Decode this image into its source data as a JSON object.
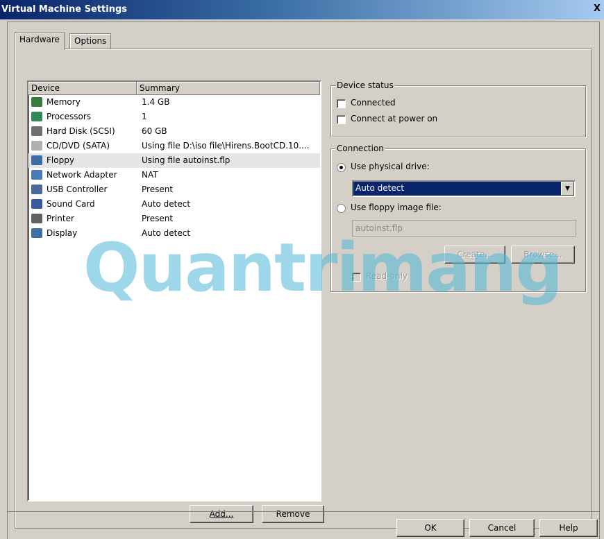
{
  "window": {
    "title": "Virtual Machine Settings",
    "close_glyph": "X"
  },
  "tabs": [
    {
      "label": "Hardware",
      "active": true
    },
    {
      "label": "Options",
      "active": false
    }
  ],
  "device_list": {
    "headers": {
      "device": "Device",
      "summary": "Summary"
    },
    "rows": [
      {
        "name": "Memory",
        "summary": "1.4 GB",
        "icon": "memory-icon",
        "color": "#3a7a3a",
        "selected": false
      },
      {
        "name": "Processors",
        "summary": "1",
        "icon": "processor-icon",
        "color": "#2e8b57",
        "selected": false
      },
      {
        "name": "Hard Disk (SCSI)",
        "summary": "60 GB",
        "icon": "hard-disk-icon",
        "color": "#707070",
        "selected": false
      },
      {
        "name": "CD/DVD (SATA)",
        "summary": "Using file D:\\iso file\\Hirens.BootCD.10....",
        "icon": "cd-dvd-icon",
        "color": "#b0b0b0",
        "selected": false
      },
      {
        "name": "Floppy",
        "summary": "Using file autoinst.flp",
        "icon": "floppy-icon",
        "color": "#3a6ea5",
        "selected": true
      },
      {
        "name": "Network Adapter",
        "summary": "NAT",
        "icon": "network-adapter-icon",
        "color": "#4a7ab8",
        "selected": false
      },
      {
        "name": "USB Controller",
        "summary": "Present",
        "icon": "usb-icon",
        "color": "#4a6a9a",
        "selected": false
      },
      {
        "name": "Sound Card",
        "summary": "Auto detect",
        "icon": "sound-card-icon",
        "color": "#3a5aa0",
        "selected": false
      },
      {
        "name": "Printer",
        "summary": "Present",
        "icon": "printer-icon",
        "color": "#606060",
        "selected": false
      },
      {
        "name": "Display",
        "summary": "Auto detect",
        "icon": "display-icon",
        "color": "#3a6ea5",
        "selected": false
      }
    ],
    "buttons": {
      "add": "Add...",
      "remove": "Remove"
    }
  },
  "device_status": {
    "title": "Device status",
    "connected": {
      "label": "Connected",
      "checked": false
    },
    "connect_at_power_on": {
      "label": "Connect at power on",
      "checked": false
    }
  },
  "connection": {
    "title": "Connection",
    "use_physical_drive": {
      "label": "Use physical drive:",
      "selected": true
    },
    "drive_select": {
      "value": "Auto detect"
    },
    "use_floppy_image": {
      "label": "Use floppy image file:",
      "selected": false
    },
    "image_file": {
      "value": "autoinst.flp"
    },
    "create_label": "Create...",
    "browse_label": "Browse...",
    "read_only": {
      "label": "Read-only",
      "checked": false
    }
  },
  "watermark": "Quantrimang",
  "footer": {
    "ok": "OK",
    "cancel": "Cancel",
    "help": "Help"
  }
}
